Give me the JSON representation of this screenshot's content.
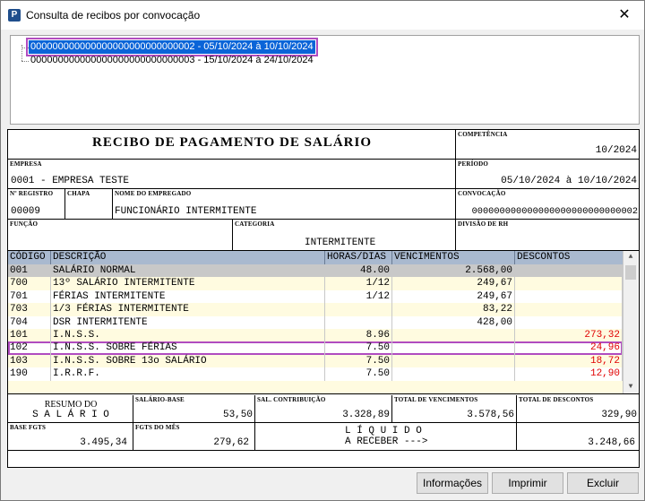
{
  "window": {
    "title": "Consulta de recibos por convocação",
    "icon": "P"
  },
  "tree": {
    "items": [
      {
        "label": "000000000000000000000000000002 - 05/10/2024 à 10/10/2024",
        "selected": true
      },
      {
        "label": "000000000000000000000000000003 - 15/10/2024 à 24/10/2024",
        "selected": false
      }
    ]
  },
  "receipt": {
    "title": "RECIBO DE PAGAMENTO DE SALÁRIO",
    "competencia_label": "COMPETÊNCIA",
    "competencia": "10/2024",
    "empresa_label": "EMPRESA",
    "empresa": "0001 - EMPRESA TESTE",
    "periodo_label": "PERÍODO",
    "periodo": "05/10/2024 à 10/10/2024",
    "registro_label": "Nº REGISTRO",
    "registro": "00009",
    "chapa_label": "CHAPA",
    "chapa": "",
    "nome_label": "NOME DO EMPREGADO",
    "nome": "FUNCIONÁRIO INTERMITENTE",
    "convocacao_label": "CONVOCAÇÃO",
    "convocacao": "000000000000000000000000000002",
    "funcao_label": "FUNÇÃO",
    "funcao": "",
    "categoria_label": "CATEGORIA",
    "categoria": "INTERMITENTE",
    "divisao_label": "DIVISÃO DE RH",
    "divisao": ""
  },
  "grid": {
    "headers": [
      "CÓDIGO",
      "DESCRIÇÃO",
      "HORAS/DIAS",
      "VENCIMENTOS",
      "DESCONTOS"
    ],
    "rows": [
      {
        "codigo": "001",
        "descricao": "SALÁRIO NORMAL",
        "horas": "48.00",
        "venc": "2.568,00",
        "desc": ""
      },
      {
        "codigo": "700",
        "descricao": "13º SALÁRIO INTERMITENTE",
        "horas": "1/12",
        "venc": "249,67",
        "desc": ""
      },
      {
        "codigo": "701",
        "descricao": "FÉRIAS INTERMITENTE",
        "horas": "1/12",
        "venc": "249,67",
        "desc": ""
      },
      {
        "codigo": "703",
        "descricao": "1/3 FÉRIAS INTERMITENTE",
        "horas": "",
        "venc": "83,22",
        "desc": ""
      },
      {
        "codigo": "704",
        "descricao": "DSR INTERMITENTE",
        "horas": "",
        "venc": "428,00",
        "desc": ""
      },
      {
        "codigo": "101",
        "descricao": "I.N.S.S.",
        "horas": "8.96",
        "venc": "",
        "desc": "273,32"
      },
      {
        "codigo": "102",
        "descricao": "I.N.S.S. SOBRE FÉRIAS",
        "horas": "7.50",
        "venc": "",
        "desc": "24,96"
      },
      {
        "codigo": "103",
        "descricao": "I.N.S.S. SOBRE 13o SALÁRIO",
        "horas": "7.50",
        "venc": "",
        "desc": "18,72"
      },
      {
        "codigo": "190",
        "descricao": "I.R.R.F.",
        "horas": "7.50",
        "venc": "",
        "desc": "12,90"
      }
    ]
  },
  "summary": {
    "resumo_line1": "RESUMO DO",
    "resumo_line2": "S A L Á R I O",
    "salario_base_label": "SALÁRIO-BASE",
    "salario_base": "53,50",
    "sal_contrib_label": "SAL. CONTRIBUIÇÃO",
    "sal_contrib": "3.328,89",
    "total_venc_label": "TOTAL DE VENCIMENTOS",
    "total_venc": "3.578,56",
    "total_desc_label": "TOTAL DE DESCONTOS",
    "total_desc": "329,90",
    "base_fgts_label": "BASE FGTS",
    "base_fgts": "3.495,34",
    "fgts_mes_label": "FGTS DO MÊS",
    "fgts_mes": "279,62",
    "liquido_line1": "L Í Q U I D O",
    "liquido_line2": "A RECEBER --->",
    "liquido": "3.248,66"
  },
  "buttons": {
    "info": "Informações",
    "print": "Imprimir",
    "delete": "Excluir"
  },
  "colors": {
    "selection": "#0a64d8",
    "highlight": "#b04cc0",
    "header": "#a9b9cf",
    "alt_row": "#fffbe0",
    "first_row": "#c8c8c8",
    "negative": "#e00000"
  }
}
